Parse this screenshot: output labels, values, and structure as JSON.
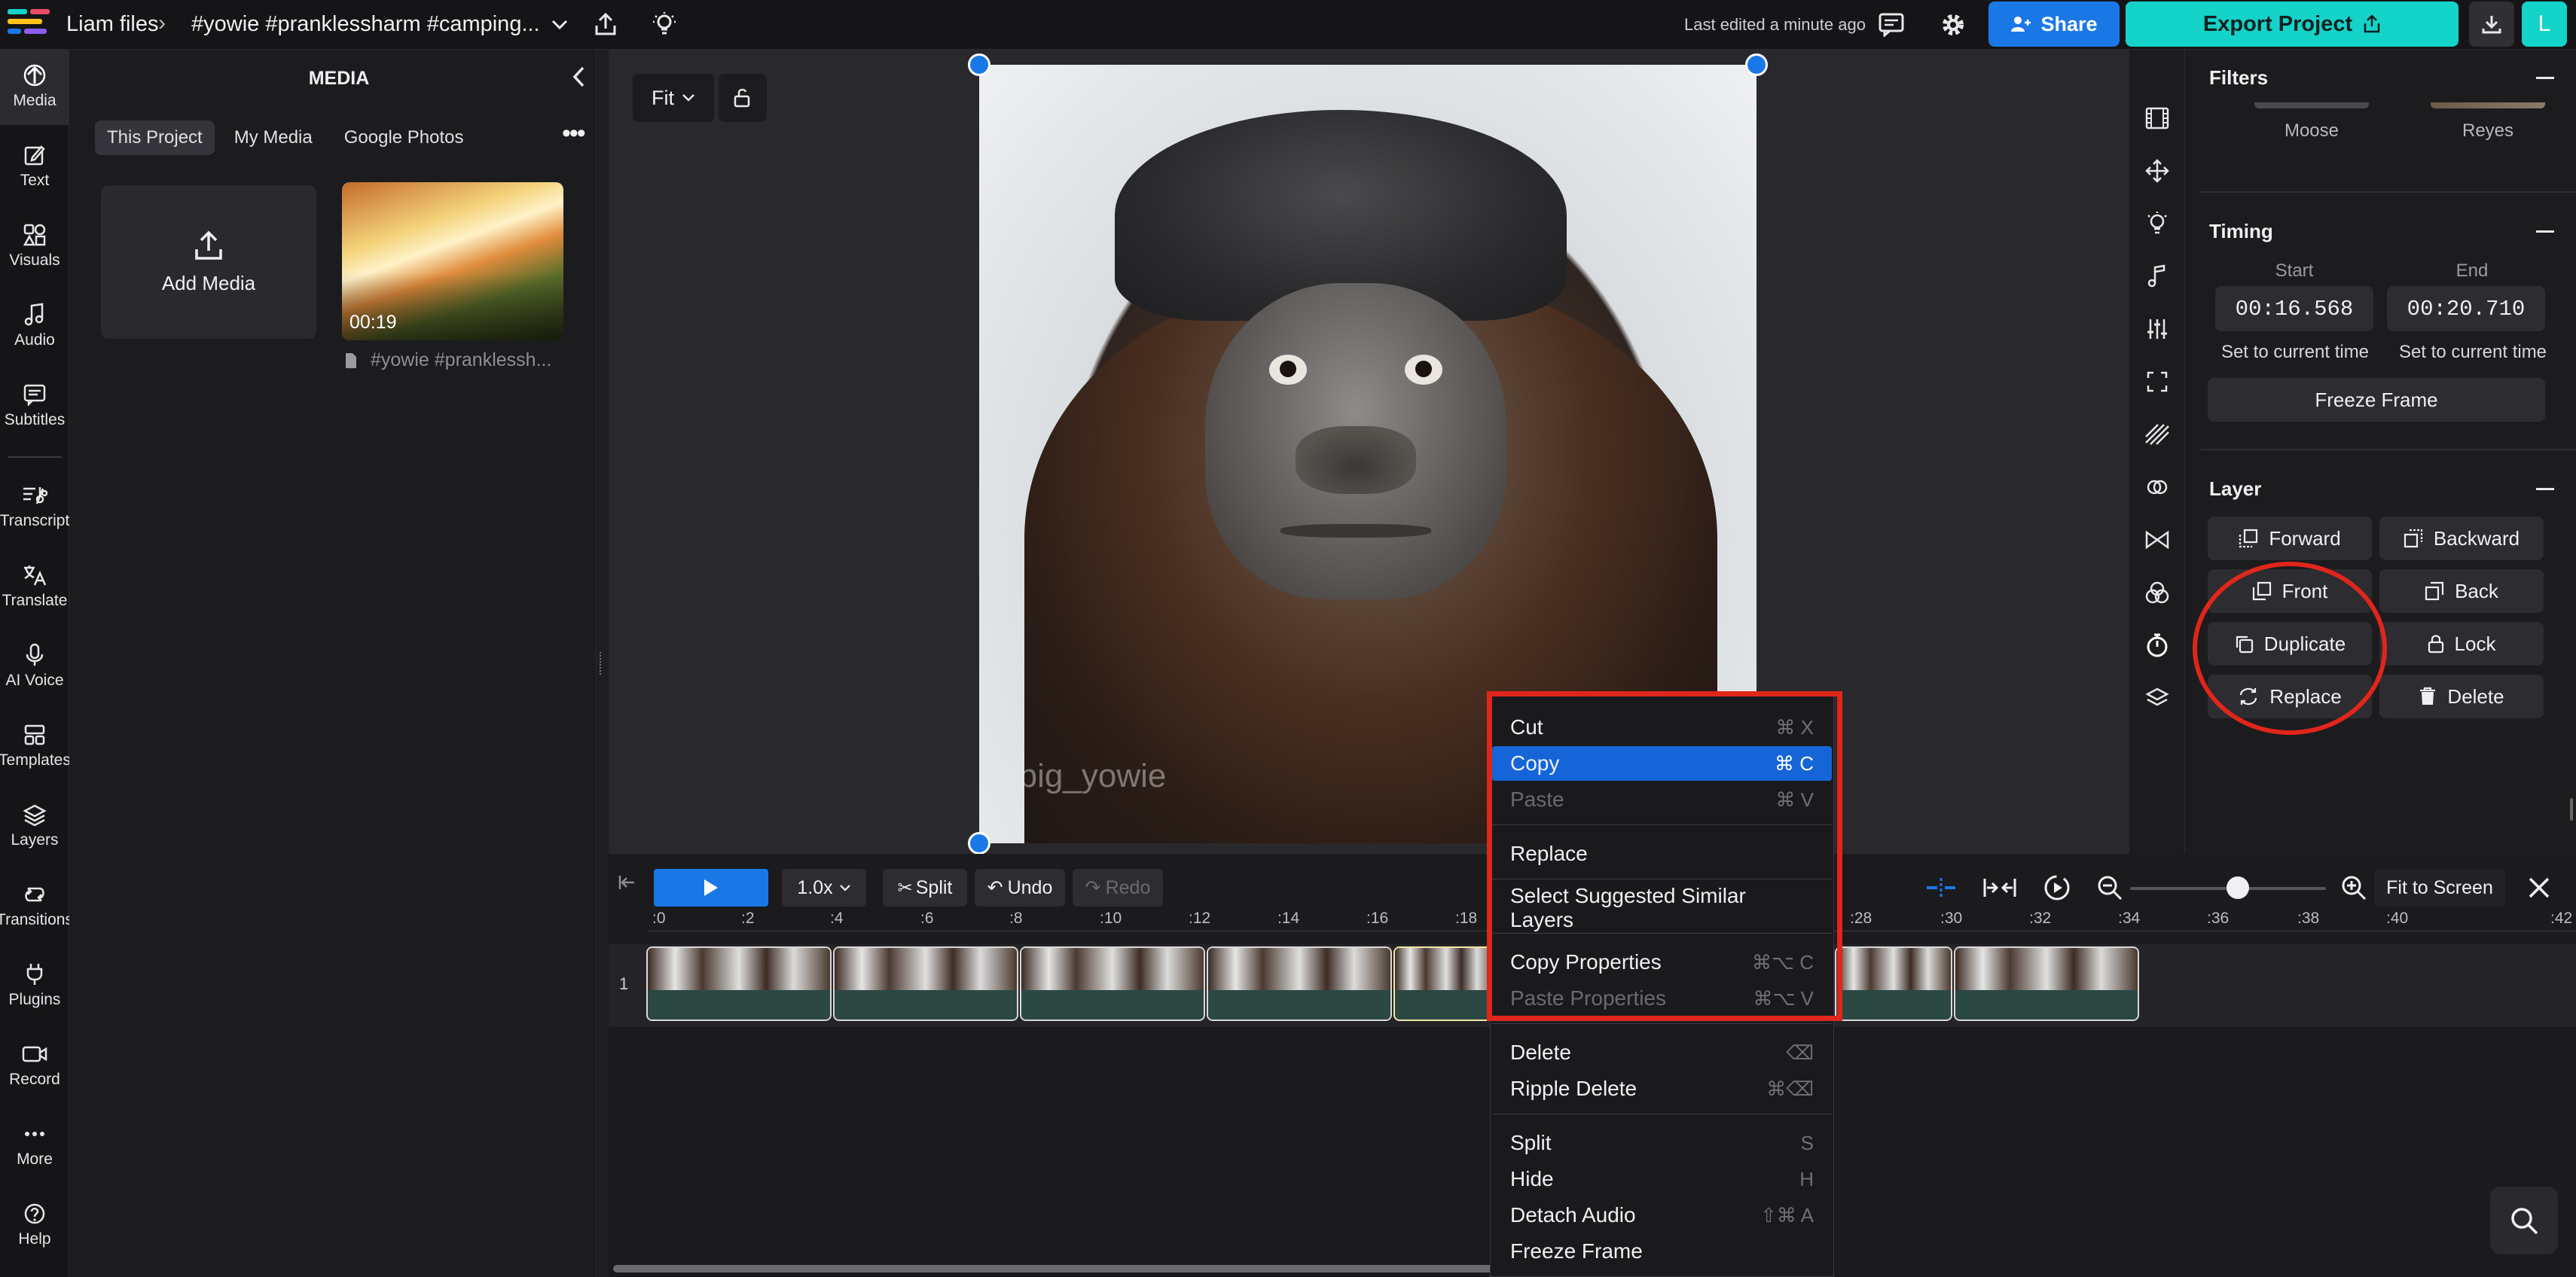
{
  "topbar": {
    "folder": "Liam files",
    "project_title": "#yowie #pranklessharm #camping...",
    "last_edited": "Last edited a minute ago",
    "share_label": "Share",
    "export_label": "Export Project",
    "avatar_letter": "L"
  },
  "leftnav": {
    "items": [
      {
        "label": "Media",
        "icon": "upload-icon"
      },
      {
        "label": "Text",
        "icon": "edit-icon"
      },
      {
        "label": "Visuals",
        "icon": "shapes-icon"
      },
      {
        "label": "Audio",
        "icon": "music-note-icon"
      },
      {
        "label": "Subtitles",
        "icon": "subtitles-icon"
      },
      {
        "label": "Transcript",
        "icon": "transcript-icon"
      },
      {
        "label": "Translate",
        "icon": "translate-icon"
      },
      {
        "label": "AI Voice",
        "icon": "microphone-icon"
      },
      {
        "label": "Templates",
        "icon": "templates-icon"
      },
      {
        "label": "Layers",
        "icon": "layers-icon"
      },
      {
        "label": "Transitions",
        "icon": "transitions-icon"
      },
      {
        "label": "Plugins",
        "icon": "plug-icon"
      },
      {
        "label": "Record",
        "icon": "record-icon"
      },
      {
        "label": "More",
        "icon": "more-icon"
      },
      {
        "label": "Help",
        "icon": "help-icon"
      }
    ]
  },
  "media": {
    "title": "MEDIA",
    "tabs": [
      "This Project",
      "My Media",
      "Google Photos"
    ],
    "add_media_label": "Add Media",
    "item": {
      "duration": "00:19",
      "name": "#yowie #pranklessh..."
    }
  },
  "canvas": {
    "fit_label": "Fit",
    "watermark": "@big_yowie"
  },
  "props": {
    "filters": {
      "title": "Filters",
      "items": [
        "Moose",
        "Reyes"
      ]
    },
    "timing": {
      "title": "Timing",
      "start_label": "Start",
      "end_label": "End",
      "start_value": "00:16.568",
      "end_value": "00:20.710",
      "set_current": "Set to current time",
      "freeze_label": "Freeze Frame"
    },
    "layer": {
      "title": "Layer",
      "forward": "Forward",
      "backward": "Backward",
      "front": "Front",
      "back": "Back",
      "duplicate": "Duplicate",
      "lock": "Lock",
      "replace": "Replace",
      "delete": "Delete"
    }
  },
  "timeline": {
    "speed": "1.0x",
    "split": "Split",
    "undo": "Undo",
    "redo": "Redo",
    "fit_screen": "Fit to Screen",
    "zoom_level": 0.55,
    "ticks": [
      ":0",
      ":2",
      ":4",
      ":6",
      ":8",
      ":10",
      ":12",
      ":14",
      ":16",
      ":18",
      ":28",
      ":30",
      ":32",
      ":34",
      ":36",
      ":38",
      ":40",
      ":42"
    ],
    "track_number": "1"
  },
  "context_menu": {
    "items": [
      {
        "label": "Cut",
        "shortcut": "⌘ X"
      },
      {
        "label": "Copy",
        "shortcut": "⌘ C"
      },
      {
        "label": "Paste",
        "shortcut": "⌘ V"
      },
      {
        "label": "Replace",
        "shortcut": ""
      },
      {
        "label": "Select Suggested Similar Layers",
        "shortcut": ""
      },
      {
        "label": "Copy Properties",
        "shortcut": "⌘⌥ C"
      },
      {
        "label": "Paste Properties",
        "shortcut": "⌘⌥ V"
      },
      {
        "label": "Delete",
        "shortcut": "⌫"
      },
      {
        "label": "Ripple Delete",
        "shortcut": "⌘⌫"
      },
      {
        "label": "Split",
        "shortcut": "S"
      },
      {
        "label": "Hide",
        "shortcut": "H"
      },
      {
        "label": "Detach Audio",
        "shortcut": "⇧⌘ A"
      },
      {
        "label": "Freeze Frame",
        "shortcut": ""
      }
    ]
  },
  "colors": {
    "accent_blue": "#1a78e6",
    "accent_teal": "#14d3c8",
    "annotation_red": "#e0261b"
  }
}
